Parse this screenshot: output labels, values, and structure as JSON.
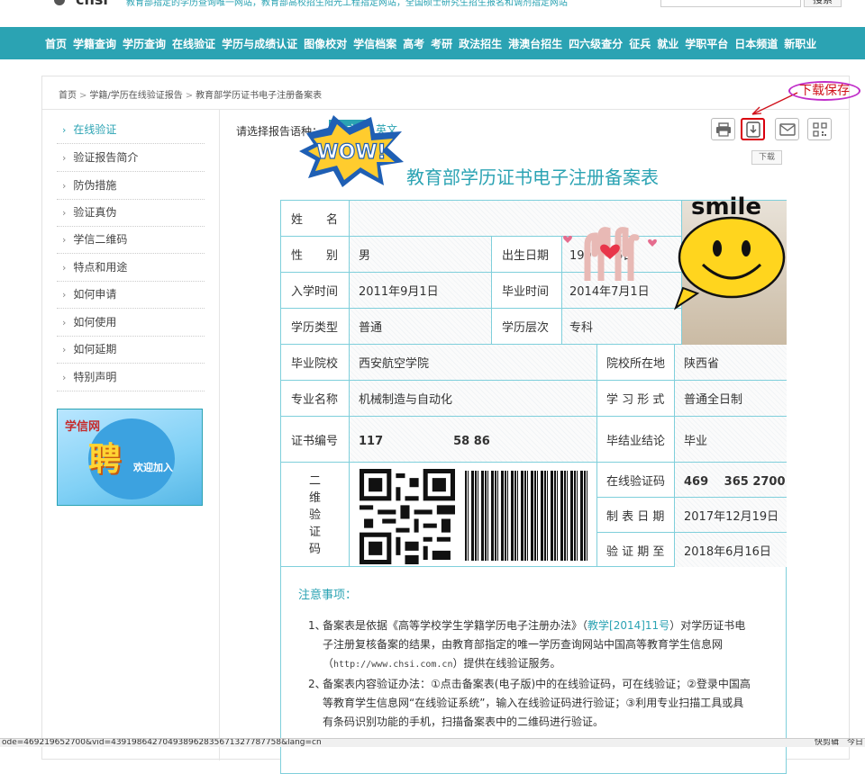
{
  "header": {
    "logo_text": "chsi",
    "description": "教育部指定的学历查询唯一网站，教育部高校招生阳光工程指定网站，全国硕士研究生招生报名和调剂指定网站",
    "search_button": "搜索"
  },
  "nav": {
    "items": [
      "首页",
      "学籍查询",
      "学历查询",
      "在线验证",
      "学历与成绩认证",
      "图像校对",
      "学信档案",
      "高考",
      "考研",
      "政法招生",
      "港澳台招生",
      "四六级查分",
      "征兵",
      "就业",
      "学职平台",
      "日本频道",
      "新职业"
    ]
  },
  "breadcrumb": {
    "home": "首页",
    "level2": "学籍/学历在线验证报告",
    "current": "教育部学历证书电子注册备案表"
  },
  "sidebar": {
    "items": [
      {
        "label": "在线验证",
        "active": true
      },
      {
        "label": "验证报告简介"
      },
      {
        "label": "防伪措施"
      },
      {
        "label": "验证真伪"
      },
      {
        "label": "学信二维码"
      },
      {
        "label": "特点和用途"
      },
      {
        "label": "如何申请"
      },
      {
        "label": "如何使用"
      },
      {
        "label": "如何延期"
      },
      {
        "label": "特别声明"
      }
    ],
    "banner": {
      "brand": "学信网",
      "main": "聘",
      "sub": "欢迎加入"
    }
  },
  "report": {
    "lang_label": "请选择报告语种：",
    "lang_cn": "中文",
    "lang_en": "英文",
    "tooltip": "下载",
    "annotation": "下载保存",
    "title": "教育部学历证书电子注册备案表",
    "fields": {
      "name_label": "姓　　名",
      "gender_label": "性　　别",
      "gender": "男",
      "birth_label": "出生日期",
      "birth": "199　　6日",
      "enroll_label": "入学时间",
      "enroll": "2011年9月1日",
      "grad_label": "毕业时间",
      "grad": "2014年7月1日",
      "edu_type_label": "学历类型",
      "edu_type": "普通",
      "edu_level_label": "学历层次",
      "edu_level": "专科",
      "school_label": "毕业院校",
      "school": "西安航空学院",
      "school_loc_label": "院校所在地",
      "school_loc": "陕西省",
      "major_label": "专业名称",
      "major": "机械制造与自动化",
      "form_label": "学 习 形 式",
      "form": "普通全日制",
      "cert_label": "证书编号",
      "cert": "117　　　　　　58 86",
      "conclusion_label": "毕结业结论",
      "conclusion": "毕业",
      "qr_label": [
        "二",
        "维",
        "验",
        "证",
        "码"
      ],
      "verify_code_label": "在线验证码",
      "verify_code": "469　 365 2700",
      "made_date_label": "制 表 日 期",
      "made_date": "2017年12月19日",
      "valid_until_label": "验 证 期 至",
      "valid_until": "2018年6月16日"
    },
    "stickers": {
      "wow": "WOW!",
      "smile": "smile"
    }
  },
  "notes": {
    "title": "注意事项：",
    "item1_num": "1、",
    "item1_a": "备案表是依据《高等学校学生学籍学历电子注册办法》（",
    "item1_link": "教学[2014]11号",
    "item1_b": "）对学历证书电子注册复核备案的结果，由教育部指定的唯一学历查询网站中国高等教育学生信息网（",
    "item1_url": "http://www.chsi.com.cn",
    "item1_c": "）提供在线验证服务。",
    "item2_num": "2、",
    "item2": "备案表内容验证办法：①点击备案表(电子版)中的在线验证码，可在线验证；②登录中国高等教育学生信息网“在线验证系统”，输入在线验证码进行验证；③利用专业扫描工具或具有条码识别功能的手机，扫描备案表中的二维码进行验证。"
  },
  "status": {
    "url": "ode=469219652700&vid=439198642704938962835671327787758&lang=cn",
    "right": "快剪辑　今日"
  }
}
